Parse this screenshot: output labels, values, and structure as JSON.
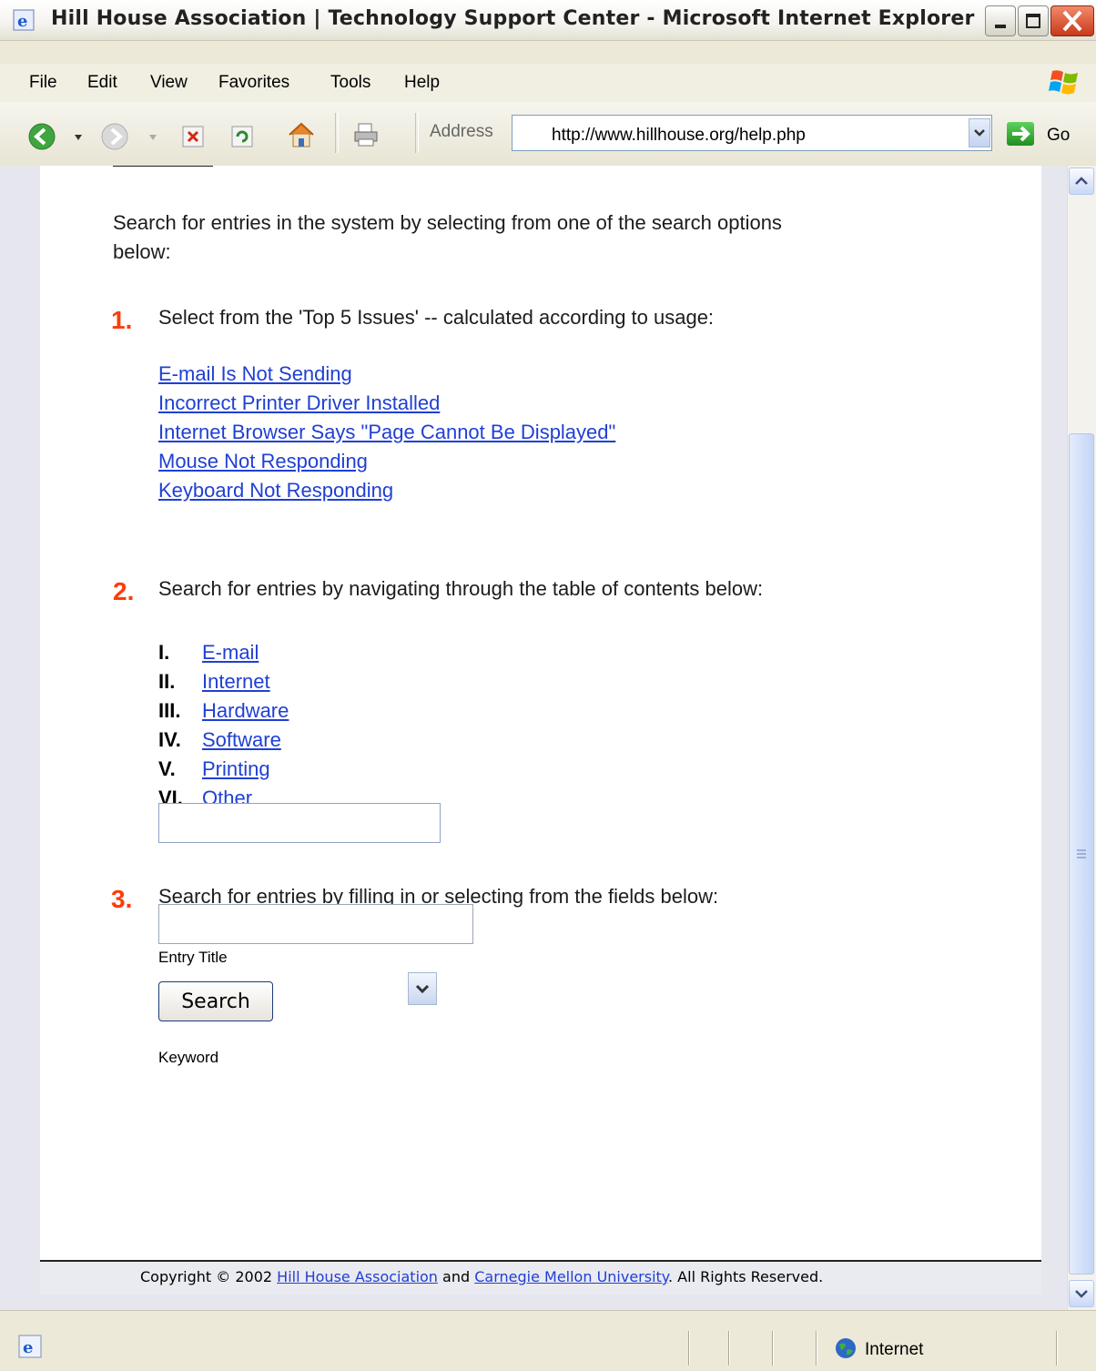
{
  "window": {
    "title": "Hill House Association | Technology Support Center - Microsoft Internet Explorer"
  },
  "menu": [
    "File",
    "Edit",
    "View",
    "Favorites",
    "Tools",
    "Help"
  ],
  "toolbar": {
    "address_label": "Address",
    "address_url": "http://www.hillhouse.org/help.php",
    "go_label": "Go"
  },
  "content": {
    "intro": "Search for entries in the system by selecting from one of the search options",
    "intro_line2": "below:",
    "section1": {
      "number": "1.",
      "text": "Select from the 'Top 5 Issues' -- calculated according to usage:",
      "links": [
        "E-mail Is Not Sending",
        "Incorrect Printer Driver Installed",
        "Internet Browser Says \"Page Cannot Be Displayed\"",
        "Mouse Not Responding",
        "Keyboard Not Responding"
      ]
    },
    "section2": {
      "number": "2.",
      "text": "Search for entries by navigating through the table of contents below:",
      "toc": [
        {
          "numeral": "I.",
          "label": "E-mail"
        },
        {
          "numeral": "II.",
          "label": "Internet"
        },
        {
          "numeral": "III.",
          "label": "Hardware"
        },
        {
          "numeral": "IV.",
          "label": "Software"
        },
        {
          "numeral": "V.",
          "label": "Printing"
        },
        {
          "numeral": "VI.",
          "label": "Other"
        }
      ]
    },
    "section3": {
      "number": "3.",
      "text": "Search for entries by filling in or selecting from the fields below:",
      "entry_title_label": "Entry Title",
      "entry_title_value": "",
      "keyword_label": "Keyword",
      "keyword_value": "",
      "search_button": "Search"
    }
  },
  "footer": {
    "prefix": "Copyright © 2002 ",
    "link1": "Hill House Association",
    "middle": " and ",
    "link2": "Carnegie Mellon University",
    "suffix": ". All Rights Reserved."
  },
  "status": {
    "zone": "Internet"
  },
  "colors": {
    "link": "#1f3fd4",
    "number_accent": "#ff3b0a"
  }
}
